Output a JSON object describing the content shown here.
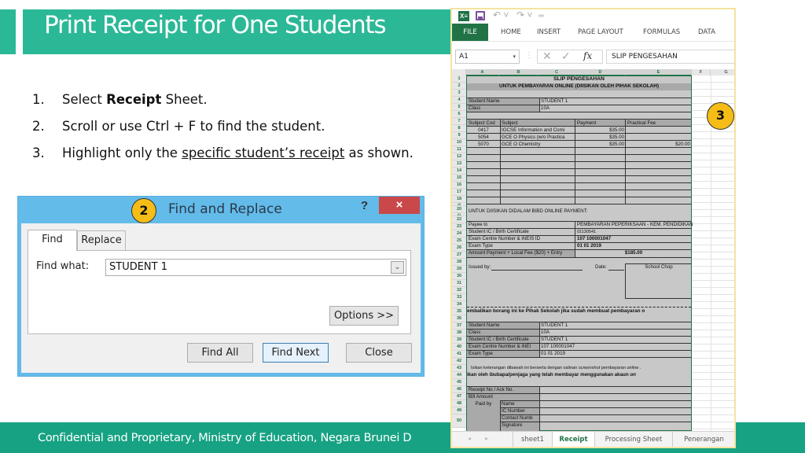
{
  "slide": {
    "title": "Print Receipt for One Students",
    "steps": [
      {
        "num": "1.",
        "pre": "Select ",
        "bold": "Receipt",
        "post": " Sheet."
      },
      {
        "num": "2.",
        "text": "Scroll or use Ctrl + F to find the student."
      },
      {
        "num": "3.",
        "pre": "Highlight only the ",
        "underline": "specific student’s receipt",
        "post": " as shown."
      }
    ],
    "footer": "Confidential and Proprietary, Ministry of Education, Negara Brunei D",
    "badges": {
      "dialog": "2",
      "sheet": "3"
    },
    "colors": {
      "teal": "#2bb896",
      "footer_teal": "#17a283",
      "badge_yellow": "#f6bd16",
      "excel_green": "#217346",
      "dialog_blue": "#63bbe9",
      "close_red": "#c9484a"
    }
  },
  "dialog": {
    "title": "Find and Replace",
    "help": "?",
    "close": "×",
    "tabs": [
      "Find",
      "Replace"
    ],
    "find_label": "Find what:",
    "find_value": "STUDENT 1",
    "dropdown_icon": "⌄",
    "buttons": {
      "options": "Options >>",
      "find_all": "Find All",
      "find_next": "Find Next",
      "close": "Close"
    }
  },
  "excel": {
    "qat": {
      "app_icon": "X≡",
      "undo": "↶ ˅",
      "redo": "↷ ˅",
      "more": "═"
    },
    "ribbon_tabs": [
      "FILE",
      "HOME",
      "INSERT",
      "PAGE LAYOUT",
      "FORMULAS",
      "DATA"
    ],
    "name_box": "A1",
    "name_box_dd": "▾",
    "fx": {
      "cancel": "✕",
      "enter": "✓",
      "icon": "fx",
      "sep": "⋮"
    },
    "formula": "SLIP PENGESAHAN",
    "columns": [
      "A",
      "B",
      "C",
      "D",
      "E",
      "F",
      "G"
    ],
    "rows": [
      "1",
      "2",
      "3",
      "4",
      "5",
      "6",
      "7",
      "8",
      "9",
      "10",
      "11",
      "12",
      "13",
      "14",
      "15",
      "16",
      "17",
      "18",
      "19",
      "20",
      "21",
      "22",
      "23",
      "24",
      "25",
      "26",
      "27",
      "28",
      "29",
      "30",
      "31",
      "32",
      "33",
      "34",
      "35",
      "36",
      "37",
      "38",
      "39",
      "40",
      "41",
      "42",
      "43",
      "44",
      "45",
      "46",
      "47",
      "48",
      "49",
      "50"
    ],
    "cells": {
      "r1": "SLIP PENGESAHAN",
      "r2": "UNTUK PEMBAYARAN ONLINE (DIISIKAN OLEH PIHAK SEKOLAH)",
      "student_name_label": "Student Name",
      "student_name": "STUDENT 1",
      "class_label": "Class",
      "class": "10A",
      "hdr_code": "Subject Cod",
      "hdr_subject": "Subject",
      "hdr_payment": "Payment",
      "hdr_practical": "Practical Fee",
      "subjects": [
        {
          "code": "0417",
          "name": "IGCSE Information and Comi",
          "payment": "$35.00",
          "practical": ""
        },
        {
          "code": "5054",
          "name": "GCE O Physics (w/o Practica",
          "payment": "$35.00",
          "practical": ""
        },
        {
          "code": "5070",
          "name": "GCE O Chemistry",
          "payment": "$35.00",
          "practical": "$20.00"
        }
      ],
      "r20": "UNTUK DIISIKAN DIDALAM BIBD ONLINE PAYMENT:",
      "payee_label": "Payee to",
      "payee": "PEMBAYARAN PEPERIKSAAN - KEM. PENDIDIKAN",
      "ic_label": "Student IC / Birth Certificate",
      "ic": "01130541",
      "exam_centre_label": "Exam Centre Number & iNEIS ID",
      "exam_centre": "107 100001047",
      "exam_type_label": "Exam Type",
      "exam_type": "01 01 2019",
      "amount_label": "Amount Payment + Local Fee ($20) + Entry",
      "amount": "$185.00",
      "issued_by": "Issued by:",
      "date": "Date:",
      "school_chop": "School Chop",
      "r34": "embalikan borang ini ke Pihak Sekolah jika sudah membuat pembayaran o",
      "r36_label": "Student Name",
      "r36": "STUDENT 1",
      "r37_label": "Class",
      "r37": "10A",
      "r38_label": "Student IC / Birth Certificate",
      "r38": "STUDENT 1",
      "r39_label": "Exam Centre Number & iNEI",
      "r39": "107 100001047",
      "r40_label": "Exam Type",
      "r40": "01 01 2019",
      "r42a": "Isikan keterangan dibawah ini berserta dengan salinan ",
      "r42b": "screenshot",
      "r42c": " pembayaran ",
      "r42d": "online",
      "r42e": " .",
      "r43a": "ikan oleh ibubapa/penjaga yang telah membayar menggunakan akaun ",
      "r43b": "on",
      "receipt_no": "Receipt No / Ack No.",
      "bill_amount": "Bill Amount",
      "paid_by": "Paid by",
      "pb_name": "Name",
      "pb_ic": "IC Number",
      "pb_contact": "Contact Numb",
      "pb_signature": "Signature"
    },
    "sheet_nav": {
      "prev": "◂",
      "next": "▸"
    },
    "sheet_tabs": [
      {
        "label": "sheet1",
        "active": false
      },
      {
        "label": "Receipt",
        "active": true
      },
      {
        "label": "Processing Sheet",
        "active": false
      },
      {
        "label": "Penerangan",
        "active": false
      }
    ]
  }
}
